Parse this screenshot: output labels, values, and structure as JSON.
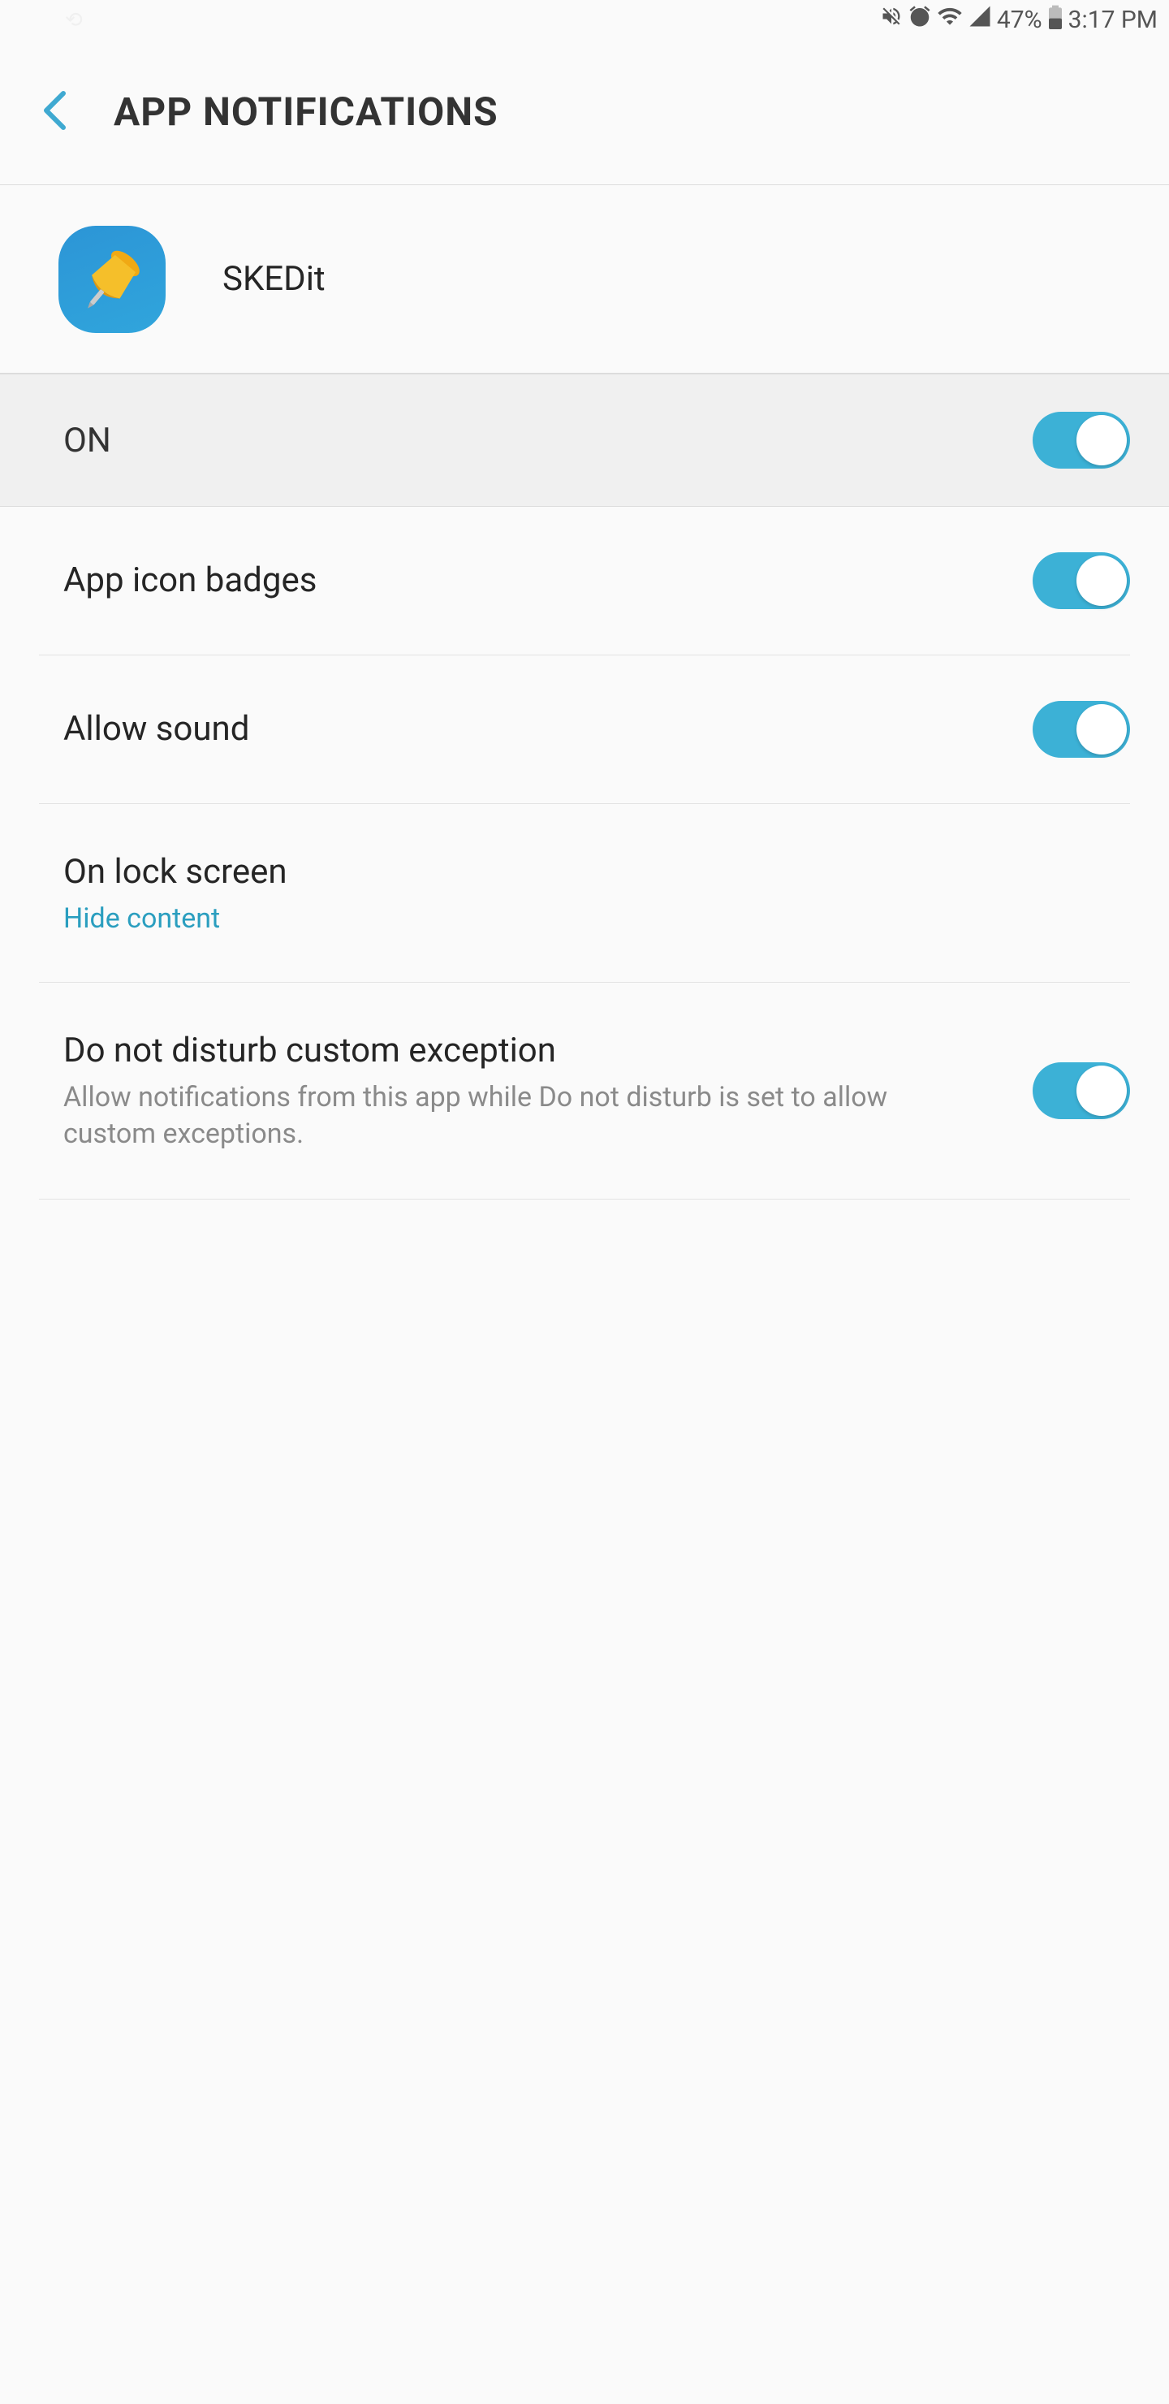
{
  "status": {
    "battery": "47%",
    "time": "3:17 PM"
  },
  "header": {
    "title": "APP NOTIFICATIONS"
  },
  "app": {
    "name": "SKEDit",
    "icon_semantic": "pushpin-icon"
  },
  "master": {
    "label": "ON",
    "enabled": true
  },
  "settings": [
    {
      "title": "App icon badges",
      "toggle": true
    },
    {
      "title": "Allow sound",
      "toggle": true
    },
    {
      "title": "On lock screen",
      "sub": "Hide content"
    },
    {
      "title": "Do not disturb custom exception",
      "desc": "Allow notifications from this app while Do not disturb is set to allow custom exceptions.",
      "toggle": true
    }
  ],
  "colors": {
    "accent": "#3cb1d6",
    "link": "#2a9ebf"
  }
}
